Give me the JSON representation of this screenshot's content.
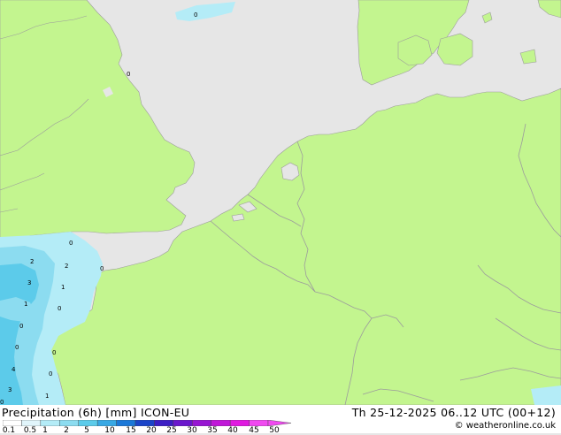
{
  "map": {
    "colors": {
      "sea": "#e6e6e6",
      "land": "#c3f58f",
      "border": "#9c9c9c",
      "precip_light": "#b4ecf7",
      "precip_mid": "#8cdcf0",
      "precip_heavy": "#5ccbea"
    },
    "precip_labels": [
      {
        "text": "0"
      },
      {
        "text": "0"
      },
      {
        "text": "0"
      },
      {
        "text": "2"
      },
      {
        "text": "2"
      },
      {
        "text": "3"
      },
      {
        "text": "1"
      },
      {
        "text": "1"
      },
      {
        "text": "0"
      },
      {
        "text": "0"
      },
      {
        "text": "0"
      },
      {
        "text": "0"
      },
      {
        "text": "0"
      },
      {
        "text": "4"
      },
      {
        "text": "0"
      },
      {
        "text": "3"
      },
      {
        "text": "1"
      },
      {
        "text": "0"
      }
    ]
  },
  "footer": {
    "title": "Precipitation (6h) [mm] ICON-EU",
    "run_info": "Th 25-12-2025 06..12 UTC (00+12)",
    "credit": "© weatheronline.co.uk"
  },
  "colorbar": {
    "ticks": [
      "0.1",
      "0.5",
      "1",
      "2",
      "5",
      "10",
      "15",
      "20",
      "25",
      "30",
      "35",
      "40",
      "45",
      "50"
    ],
    "colors": [
      "#ffffff",
      "#e1f5fb",
      "#b4ecf7",
      "#8cdcf0",
      "#5ccbea",
      "#38a8e4",
      "#1b78d8",
      "#1b44c8",
      "#3c1ec4",
      "#6a17cc",
      "#9716d2",
      "#c018d8",
      "#e01ae0",
      "#f04af0"
    ]
  }
}
